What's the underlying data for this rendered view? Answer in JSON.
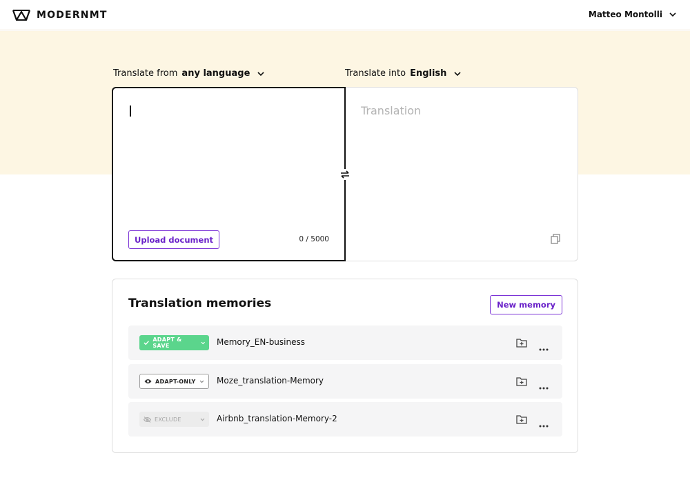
{
  "header": {
    "brand": "MODERNMT",
    "user_name": "Matteo Montolli"
  },
  "translator": {
    "from_prefix": "Translate from",
    "from_value": "any language",
    "into_prefix": "Translate into",
    "into_value": "English",
    "source_text": "",
    "upload_label": "Upload document",
    "char_count": "0 / 5000",
    "target_placeholder": "Translation"
  },
  "memories": {
    "title": "Translation memories",
    "new_label": "New memory",
    "items": [
      {
        "mode": "ADAPT & SAVE",
        "name": "Memory_EN-business"
      },
      {
        "mode": "ADAPT-ONLY",
        "name": "Moze_translation-Memory"
      },
      {
        "mode": "EXCLUDE",
        "name": "Airbnb_translation-Memory-2"
      }
    ]
  },
  "colors": {
    "accent": "#7b33d6",
    "band": "#fdf6e3",
    "adapt_save": "#5bd58c"
  },
  "icons": [
    "logo-icon",
    "chevron-down-icon",
    "swap-icon",
    "copy-icon",
    "check-icon",
    "eye-icon",
    "eye-off-icon",
    "add-folder-icon",
    "more-icon"
  ]
}
